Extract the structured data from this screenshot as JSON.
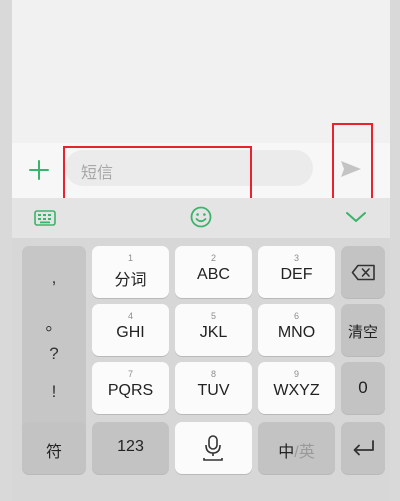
{
  "compose": {
    "placeholder": "短信"
  },
  "punctuation": [
    ",",
    "。",
    "?",
    "!"
  ],
  "keys": {
    "fenci": {
      "label": "分词",
      "num": "1"
    },
    "abc": {
      "label": "ABC",
      "num": "2"
    },
    "def": {
      "label": "DEF",
      "num": "3"
    },
    "ghi": {
      "label": "GHI",
      "num": "4"
    },
    "jkl": {
      "label": "JKL",
      "num": "5"
    },
    "mno": {
      "label": "MNO",
      "num": "6"
    },
    "pqrs": {
      "label": "PQRS",
      "num": "7"
    },
    "tuv": {
      "label": "TUV",
      "num": "8"
    },
    "wxyz": {
      "label": "WXYZ",
      "num": "9"
    },
    "clear": "清空",
    "zero": "0",
    "symbol": "符",
    "numbers": "123",
    "ime_zh": "中",
    "ime_sep": "/",
    "ime_en": "英"
  },
  "colors": {
    "accent_green": "#3bb36b",
    "highlight_red": "#e8232e"
  }
}
